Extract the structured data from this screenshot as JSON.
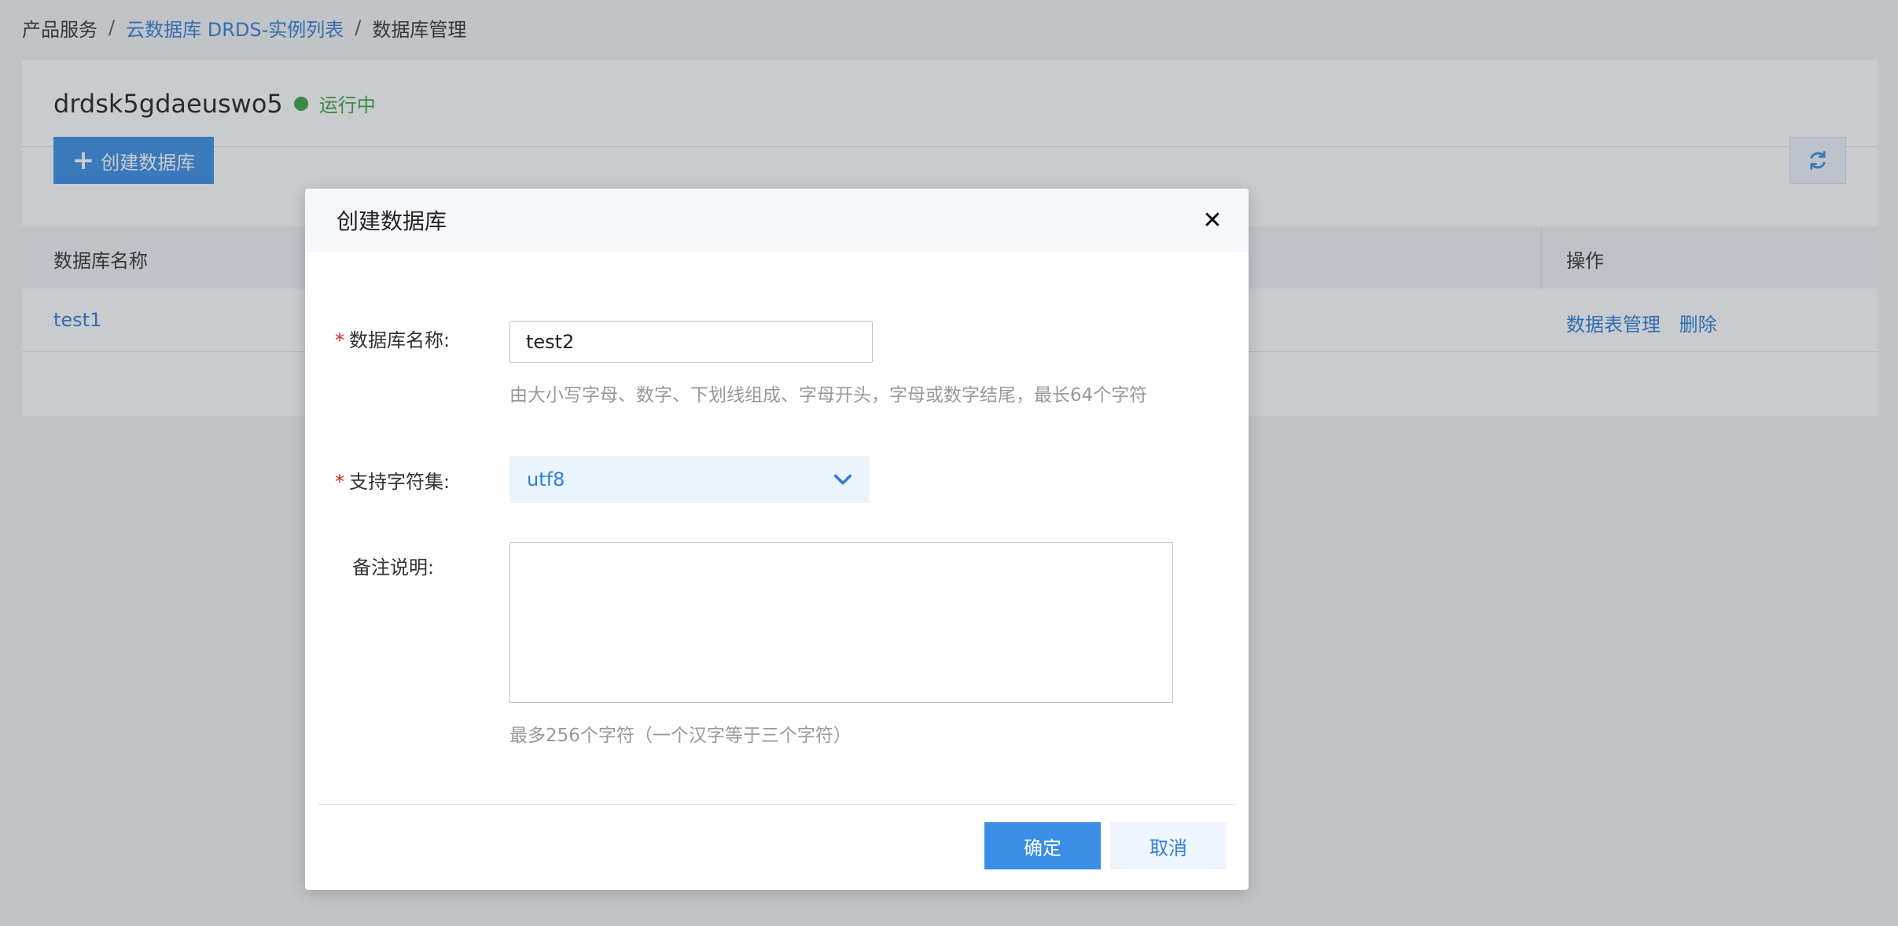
{
  "breadcrumb": {
    "items": [
      "产品服务",
      "云数据库 DRDS-实例列表",
      "数据库管理"
    ],
    "separator": "/"
  },
  "instance": {
    "name": "drdsk5gdaeuswo5",
    "status": "运行中",
    "status_color": "#3aa545"
  },
  "toolbar": {
    "create_label": "创建数据库",
    "refresh_icon": "refresh-icon"
  },
  "table": {
    "columns": [
      "数据库名称",
      "操作"
    ],
    "rows": [
      {
        "name": "test1",
        "actions": [
          "数据表管理",
          "删除"
        ]
      }
    ]
  },
  "modal": {
    "title": "创建数据库",
    "close_icon": "close-icon",
    "name_label": "数据库名称:",
    "name_value": "test2",
    "name_hint": "由大小写字母、数字、下划线组成、字母开头，字母或数字结尾，最长64个字符",
    "charset_label": "支持字符集:",
    "charset_value": "utf8",
    "remark_label": "备注说明:",
    "remark_value": "",
    "remark_hint": "最多256个字符（一个汉字等于三个字符）",
    "ok_label": "确定",
    "cancel_label": "取消"
  },
  "colors": {
    "accent": "#3a8ee6",
    "link": "#2f7fd8",
    "required": "#e02020"
  }
}
